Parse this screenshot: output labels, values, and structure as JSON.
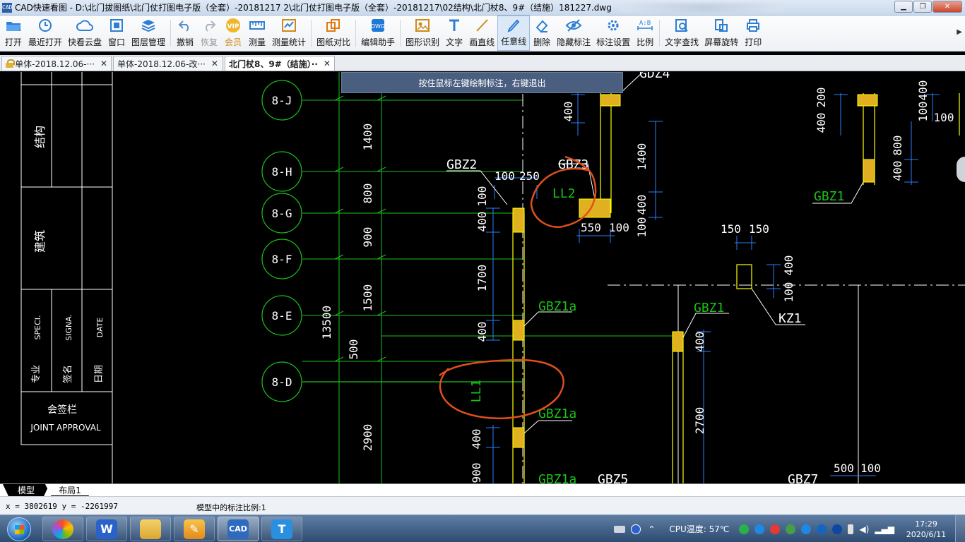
{
  "window": {
    "app_icon": "CAD",
    "title": "CAD快速看图 - D:\\北门拔图纸\\北门仗打图电子版（全套）-20181217 2\\北门仗打图电子版（全套）-20181217\\02结构\\北门杖8、9#（结施）181227.dwg"
  },
  "toolbar": {
    "items": [
      {
        "label": "打开",
        "icon": "folder-open-icon"
      },
      {
        "label": "最近打开",
        "icon": "history-icon"
      },
      {
        "label": "快看云盘",
        "icon": "cloud-icon"
      },
      {
        "label": "窗口",
        "icon": "window-icon"
      },
      {
        "label": "图层管理",
        "icon": "layers-icon"
      },
      {
        "label": "撤销",
        "icon": "undo-icon"
      },
      {
        "label": "恢复",
        "icon": "redo-icon"
      },
      {
        "label": "会员",
        "icon": "vip-icon",
        "badge": "VIP"
      },
      {
        "label": "测量",
        "icon": "ruler-icon"
      },
      {
        "label": "测量统计",
        "icon": "measure-stats-icon"
      },
      {
        "label": "图纸对比",
        "icon": "compare-icon"
      },
      {
        "label": "编辑助手",
        "icon": "edit-assistant-icon"
      },
      {
        "label": "图形识别",
        "icon": "shape-recognize-icon"
      },
      {
        "label": "文字",
        "icon": "text-icon"
      },
      {
        "label": "画直线",
        "icon": "line-icon"
      },
      {
        "label": "任意线",
        "icon": "freehand-icon"
      },
      {
        "label": "删除",
        "icon": "eraser-icon"
      },
      {
        "label": "隐藏标注",
        "icon": "hide-markup-icon"
      },
      {
        "label": "标注设置",
        "icon": "markup-settings-icon"
      },
      {
        "label": "比例",
        "icon": "scale-icon",
        "badge": "A:B"
      },
      {
        "label": "文字查找",
        "icon": "text-search-icon"
      },
      {
        "label": "屏幕旋转",
        "icon": "rotate-screen-icon"
      },
      {
        "label": "打印",
        "icon": "print-icon"
      }
    ]
  },
  "tabs": [
    {
      "label": "单体-2018.12.06-···",
      "locked": true
    },
    {
      "label": "单体-2018.12.06-改···",
      "locked": false
    },
    {
      "label": "北门杖8、9#（结施）··",
      "locked": false,
      "active": true
    }
  ],
  "canvas": {
    "hint": "按住鼠标左键绘制标注，右键退出",
    "title_block": {
      "structure": "结构",
      "architecture": "建筑",
      "speci": "SPECI.",
      "signa": "SIGNA.",
      "date": "DATE",
      "speci_cn": "专业",
      "signa_cn": "签名",
      "date_cn": "日期",
      "joint_cn": "会签栏",
      "joint_en": "JOINT APPROVAL"
    },
    "axes": [
      "8-J",
      "8-H",
      "8-G",
      "8-F",
      "8-E",
      "8-D"
    ],
    "dims_vertical": [
      "1400",
      "800",
      "900",
      "1500",
      "13500",
      "500",
      "2900"
    ],
    "labels": {
      "gdz4": "GDZ4",
      "gbz2": "GBZ2",
      "gbz3": "GBZ3",
      "d100": "100",
      "d250": "250",
      "ll2": "LL2",
      "d550": "550",
      "d100b": "100",
      "gbz1_right": "GBZ1",
      "d150a": "150",
      "d150b": "150",
      "kz1": "KZ1",
      "gbz1a_1": "GBZ1a",
      "gbz1_mid": "GBZ1",
      "ll1": "LL1",
      "gbz1a_2": "GBZ1a",
      "gbz1a_3": "GBZ1a",
      "gbz5": "GBZ5",
      "gbz7": "GBZ7",
      "d500": "500",
      "d100c": "100",
      "v400a": "400",
      "v1400": "1400",
      "v400b": "400",
      "v100a": "100",
      "v100b": "100",
      "v400c": "400",
      "v1700": "1700",
      "v400d": "400",
      "v400e": "400",
      "v900": "900",
      "v400f": "400",
      "v2700": "2700",
      "v400g": "400",
      "v100c": "100",
      "v200": "200",
      "v400h": "400",
      "v100d": "100",
      "v400i": "400",
      "v800": "800",
      "v400j": "400",
      "v100e": "100"
    },
    "colors": {
      "axis": "#19c219",
      "wall": "#ffff00",
      "dim": "#2a7fff",
      "markup": "#e0501c",
      "text": "#ffffff",
      "hatch": "#e0b020"
    }
  },
  "layout_tabs": {
    "model": "模型",
    "layout1": "布局1"
  },
  "status": {
    "coords": "x = 3802619  y = -2261997",
    "scale": "模型中的标注比例:1"
  },
  "taskbar": {
    "cpu": "CPU温度: 57℃",
    "time": "17:29",
    "date": "2020/6/11"
  }
}
